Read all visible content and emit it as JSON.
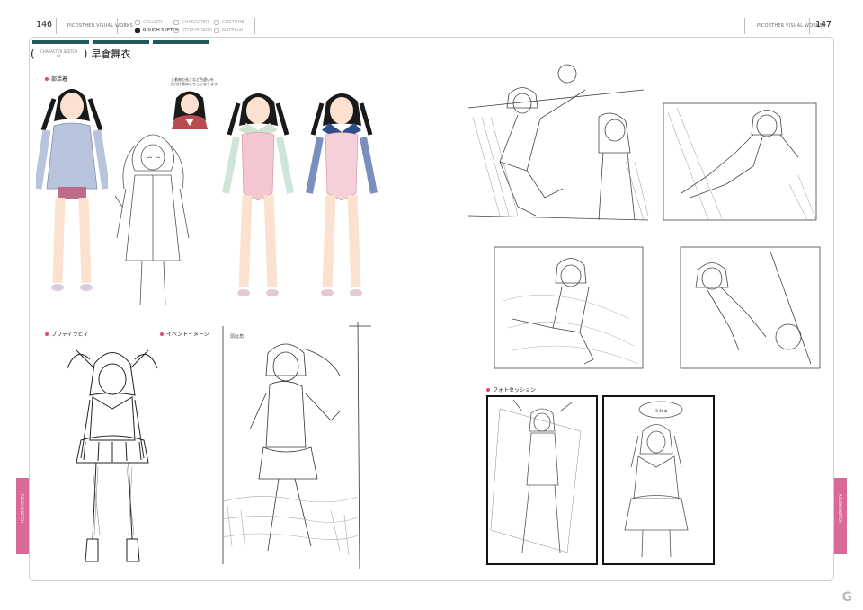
{
  "header": {
    "left_page_number": "146",
    "right_page_number": "147",
    "left_running_head": "PICOSTHER VISUAL WORKS",
    "right_running_head": "PICOSTHER VISUAL WORKS",
    "nav": [
      {
        "label": "GALLERY",
        "active": false
      },
      {
        "label": "ROUGH SKETCH",
        "active": true
      },
      {
        "label": "CHARACTER",
        "active": false
      },
      {
        "label": "STORYBOARD",
        "active": false
      },
      {
        "label": "COSTUME",
        "active": false
      },
      {
        "label": "MATERIAL",
        "active": false
      }
    ]
  },
  "title": {
    "paren_inner": "CHARACTER SKETCH 01",
    "character_name": "早倉舞衣"
  },
  "sections": {
    "club": "部活着",
    "pretty": "プリティラビィ",
    "event": "イベントイメージ",
    "photo": "フォトセッション"
  },
  "notes": {
    "portrait_note_1": "上着袖の長さなど色違いを",
    "portrait_note_2": "色付け版はこちらになります。",
    "thumbs": "頭は角",
    "bubble": "うわぁ"
  },
  "side_tabs": {
    "left": "ROUGH SKETCH",
    "right": "ROUGH SKETCH"
  },
  "colors": {
    "teal": "#1f5a5a",
    "pink_accent": "#d96a98",
    "section_dot": "#e0457b"
  },
  "watermark": "G"
}
